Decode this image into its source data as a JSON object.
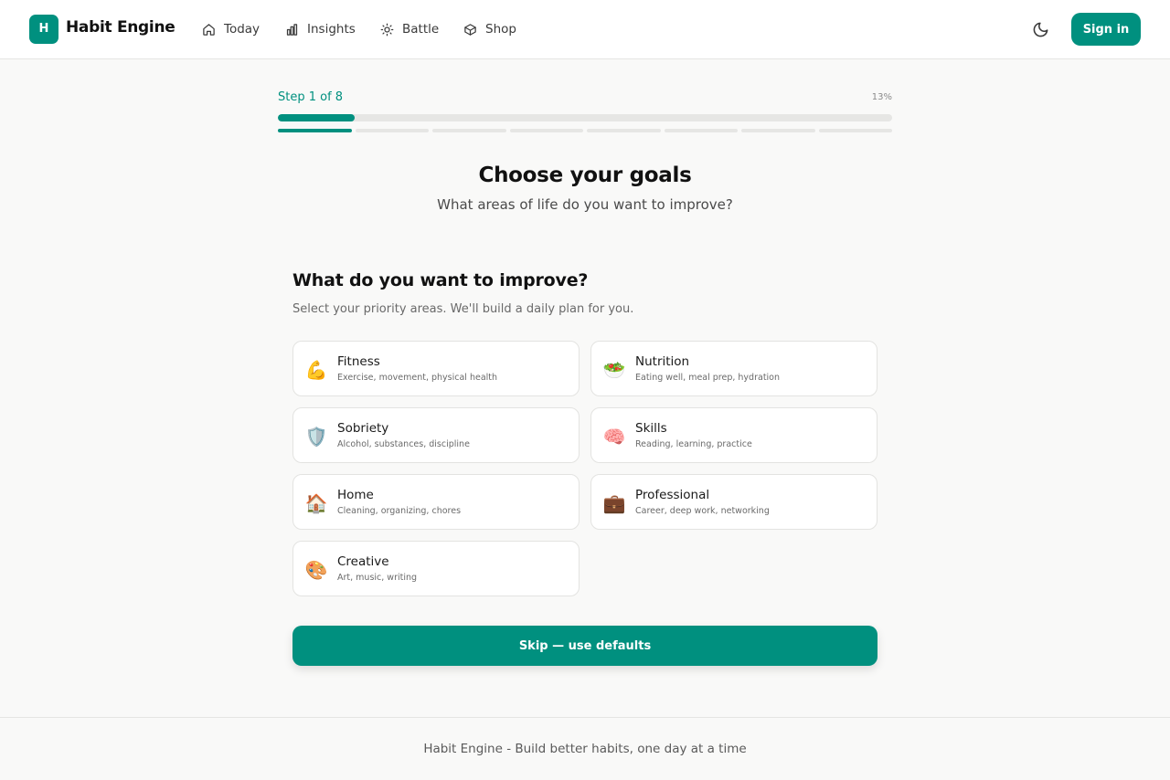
{
  "app": {
    "logo_letter": "H",
    "brand": "Habit Engine",
    "accent_color": "#00907f"
  },
  "nav": [
    {
      "label": "Today",
      "icon": "home-icon"
    },
    {
      "label": "Insights",
      "icon": "bar-chart-icon"
    },
    {
      "label": "Battle",
      "icon": "lightbulb-icon"
    },
    {
      "label": "Shop",
      "icon": "box-icon"
    }
  ],
  "header": {
    "theme_icon": "moon-icon",
    "signin_label": "Sign in"
  },
  "progress": {
    "step_label": "Step 1 of 8",
    "percent_label": "13%",
    "percent_value": 12.5,
    "current_step": 1,
    "total_steps": 8
  },
  "main": {
    "title": "Choose your goals",
    "subtitle": "What areas of life do you want to improve?",
    "question_title": "What do you want to improve?",
    "question_subtitle": "Select your priority areas. We'll build a daily plan for you."
  },
  "goals": [
    {
      "emoji": "💪",
      "title": "Fitness",
      "desc": "Exercise, movement, physical health"
    },
    {
      "emoji": "🥗",
      "title": "Nutrition",
      "desc": "Eating well, meal prep, hydration"
    },
    {
      "emoji": "🛡️",
      "title": "Sobriety",
      "desc": "Alcohol, substances, discipline"
    },
    {
      "emoji": "🧠",
      "title": "Skills",
      "desc": "Reading, learning, practice"
    },
    {
      "emoji": "🏠",
      "title": "Home",
      "desc": "Cleaning, organizing, chores"
    },
    {
      "emoji": "💼",
      "title": "Professional",
      "desc": "Career, deep work, networking"
    },
    {
      "emoji": "🎨",
      "title": "Creative",
      "desc": "Art, music, writing"
    }
  ],
  "skip_label": "Skip — use defaults",
  "footer_text": "Habit Engine - Build better habits, one day at a time"
}
